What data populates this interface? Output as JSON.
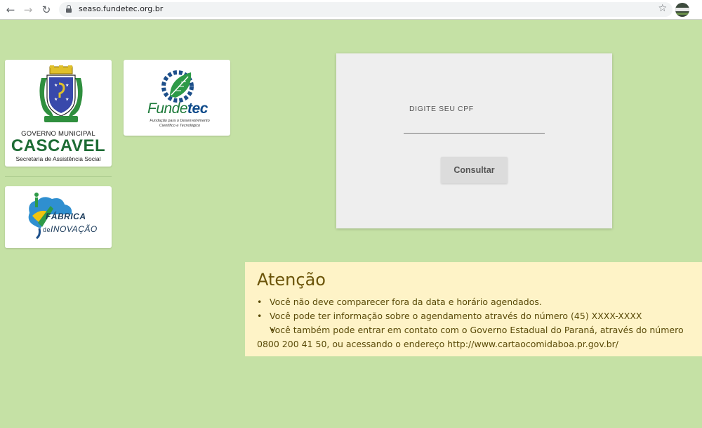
{
  "browser": {
    "url": "seaso.fundetec.org.br",
    "back_icon": "arrow-left-icon",
    "forward_icon": "arrow-right-icon",
    "reload_icon": "reload-icon",
    "bookmark_icon": "star-icon"
  },
  "logos": {
    "cascavel": {
      "emblem_text": "CASCAVEL",
      "line1": "GOVERNO MUNICIPAL",
      "line2": "CASCAVEL",
      "line3": "Secretaria de Assistência Social"
    },
    "fundetec": {
      "name_part1": "Funde",
      "name_part2": "tec",
      "subtitle": "Fundação para o Desenvolvimento Científico e Tecnológico"
    },
    "fabrica": {
      "line1": "FÁBRICA",
      "line2_prefix": "de",
      "line2": "INOVAÇÃO"
    }
  },
  "form": {
    "cpf_label": "DIGITE SEU CPF",
    "cpf_value": "",
    "submit_label": "Consultar"
  },
  "notice": {
    "title": "Atenção",
    "items": [
      "Você não deve comparecer fora da data e horário agendados.",
      "Você pode ter informação sobre o agendamento através do número (45) XXXX-XXXX",
      "Você também pode entrar em contato com o Governo Estadual do Paraná, através do número 0800 200 41 50, ou acessando o endereço http://www.cartaocomidaboa.pr.gov.br/"
    ]
  },
  "colors": {
    "page_background": "#c5e1a5",
    "notice_background": "#fef3c7",
    "notice_text": "#6b5409",
    "panel_background": "#eeeeee",
    "cascavel_green": "#1d6b34",
    "fundetec_blue": "#0e4a8a"
  }
}
